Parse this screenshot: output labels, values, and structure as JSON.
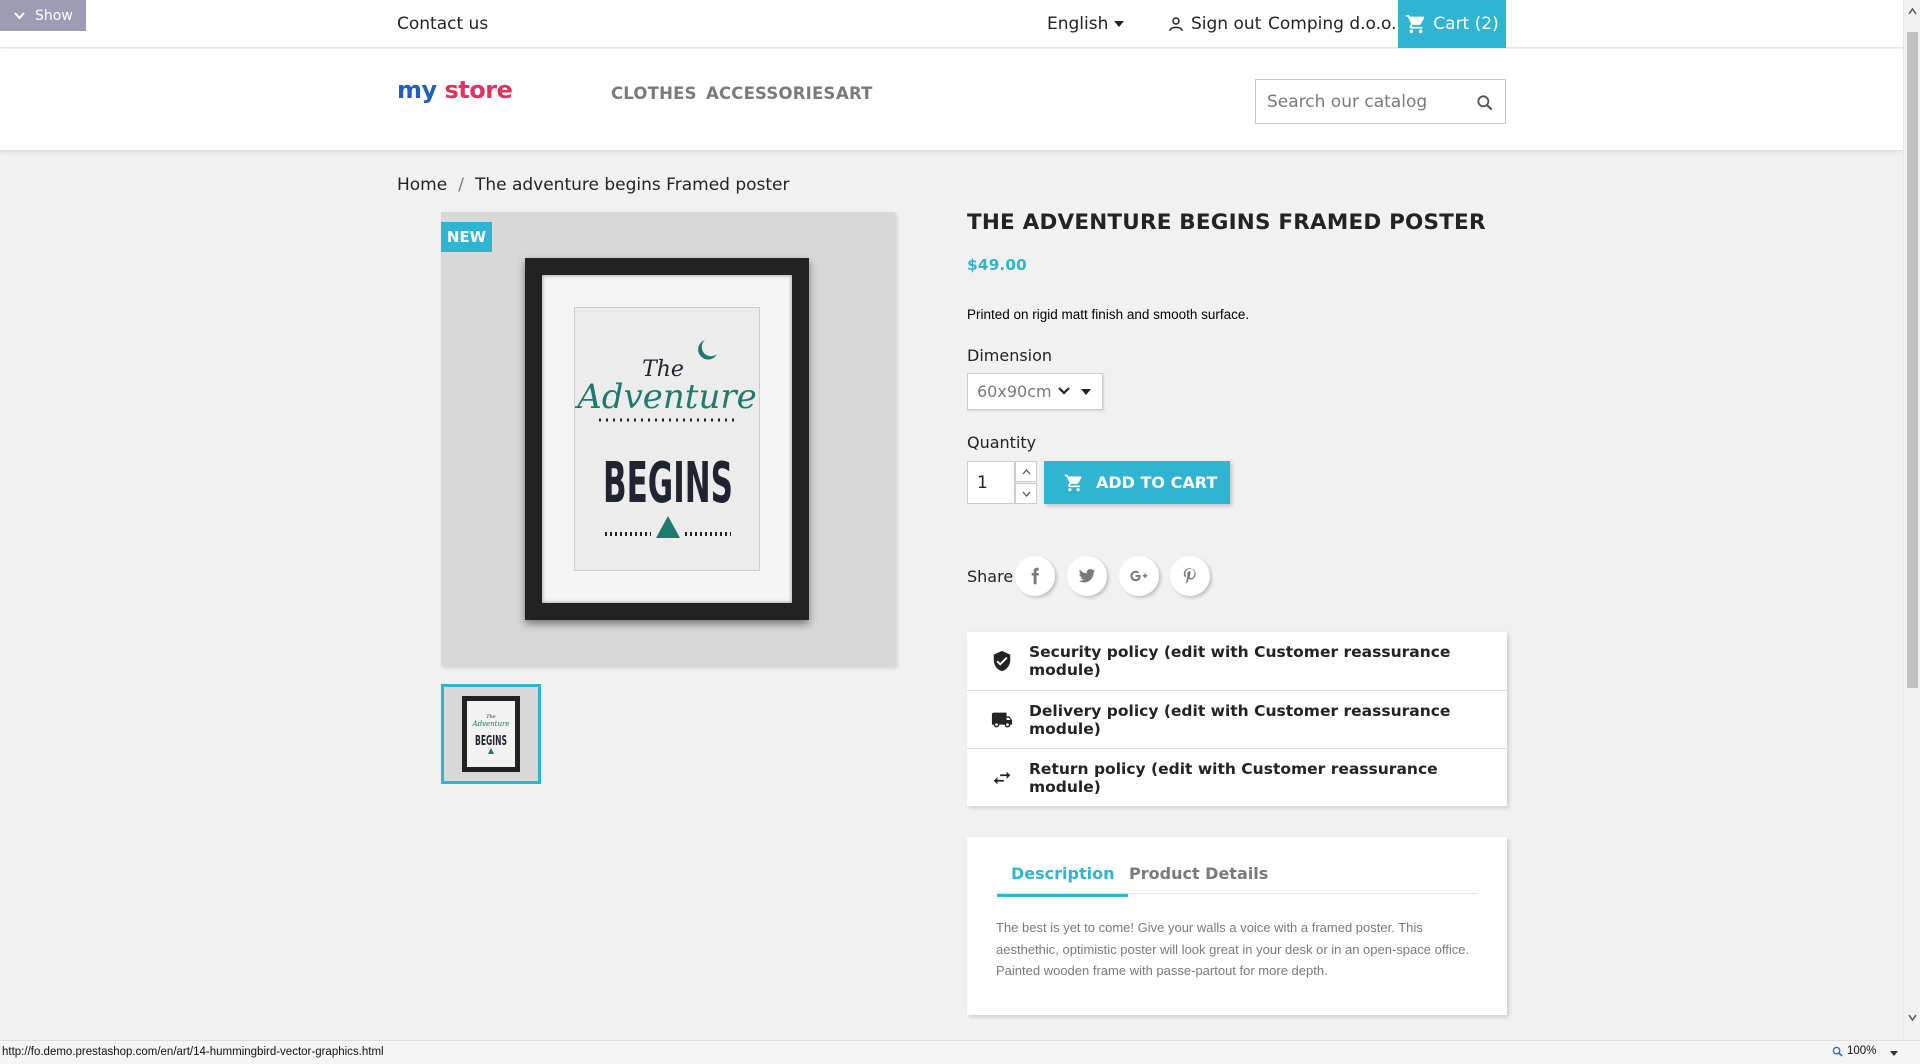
{
  "debug_bar": {
    "show_label": "Show"
  },
  "topbar": {
    "contact": "Contact us",
    "language": "English",
    "sign_out": "Sign out",
    "account_name": "Comping d.o.o.",
    "cart": "Cart (2)"
  },
  "header": {
    "logo_text_my": "my",
    "logo_text_store": "store",
    "nav": [
      "CLOTHES",
      "ACCESSORIES",
      "ART"
    ],
    "search_placeholder": "Search our catalog"
  },
  "breadcrumb": {
    "home": "Home",
    "separator": "/",
    "current": "The adventure begins Framed poster"
  },
  "product": {
    "badge": "NEW",
    "poster_line1": "The",
    "poster_line2": "Adventure",
    "poster_line3": "BEGINS",
    "thumb_line1": "The",
    "thumb_line2": "Adventure",
    "thumb_line3": "BEGINS",
    "title": "THE ADVENTURE BEGINS FRAMED POSTER",
    "price": "$49.00",
    "short_description": "Printed on rigid matt finish and smooth surface.",
    "dimension_label": "Dimension",
    "dimension_value": "60x90cm",
    "quantity_label": "Quantity",
    "quantity_value": "1",
    "add_to_cart": "ADD TO CART",
    "share_label": "Share"
  },
  "reassurance": [
    {
      "icon": "shield-check-icon",
      "text": "Security policy (edit with Customer reassurance module)"
    },
    {
      "icon": "truck-icon",
      "text": "Delivery policy (edit with Customer reassurance module)"
    },
    {
      "icon": "swap-arrows-icon",
      "text": "Return policy (edit with Customer reassurance module)"
    }
  ],
  "tabs": {
    "items": [
      "Description",
      "Product Details"
    ],
    "active": "Description",
    "description": "The best is yet to come! Give your walls a voice with a framed poster. This aesthethic, optimistic poster will look great in your desk or in an open-space office. Painted wooden frame with passe-partout for more depth."
  },
  "statusbar": {
    "url": "http://fo.demo.prestashop.com/en/art/14-hummingbird-vector-graphics.html",
    "zoom": "100%"
  },
  "colors": {
    "accent": "#2fb5d2",
    "text": "#232323",
    "muted": "#7a7a7a",
    "background": "#f1f1f1",
    "poster_teal": "#1e7a6e",
    "poster_dark": "#1f2430"
  }
}
